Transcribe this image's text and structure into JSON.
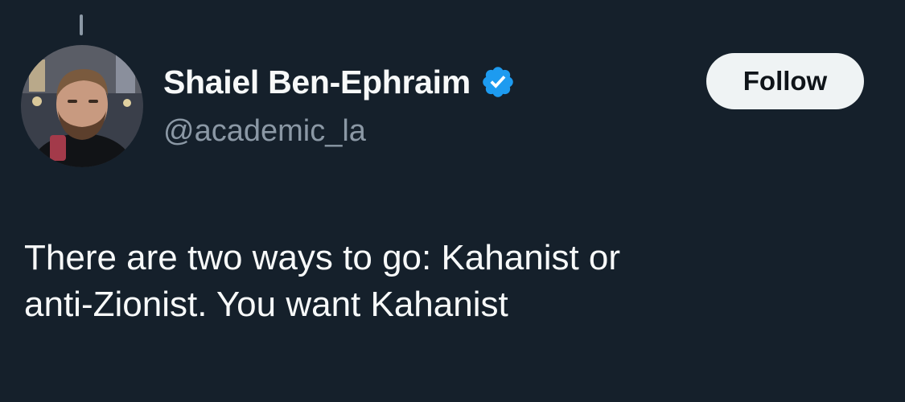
{
  "author": {
    "display_name": "Shaiel Ben-Ephraim",
    "handle": "@academic_la",
    "verified_icon": "verified-badge-icon"
  },
  "follow_button": {
    "label": "Follow"
  },
  "tweet": {
    "line1": "There are two ways to go: Kahanist or",
    "line2": "anti-Zionist. You want Kahanist"
  },
  "colors": {
    "background": "#15202b",
    "text_primary": "#f7f9f9",
    "text_secondary": "#8b98a5",
    "verified_blue": "#1d9bf0",
    "button_bg": "#eff3f4",
    "button_text": "#0f1419"
  }
}
